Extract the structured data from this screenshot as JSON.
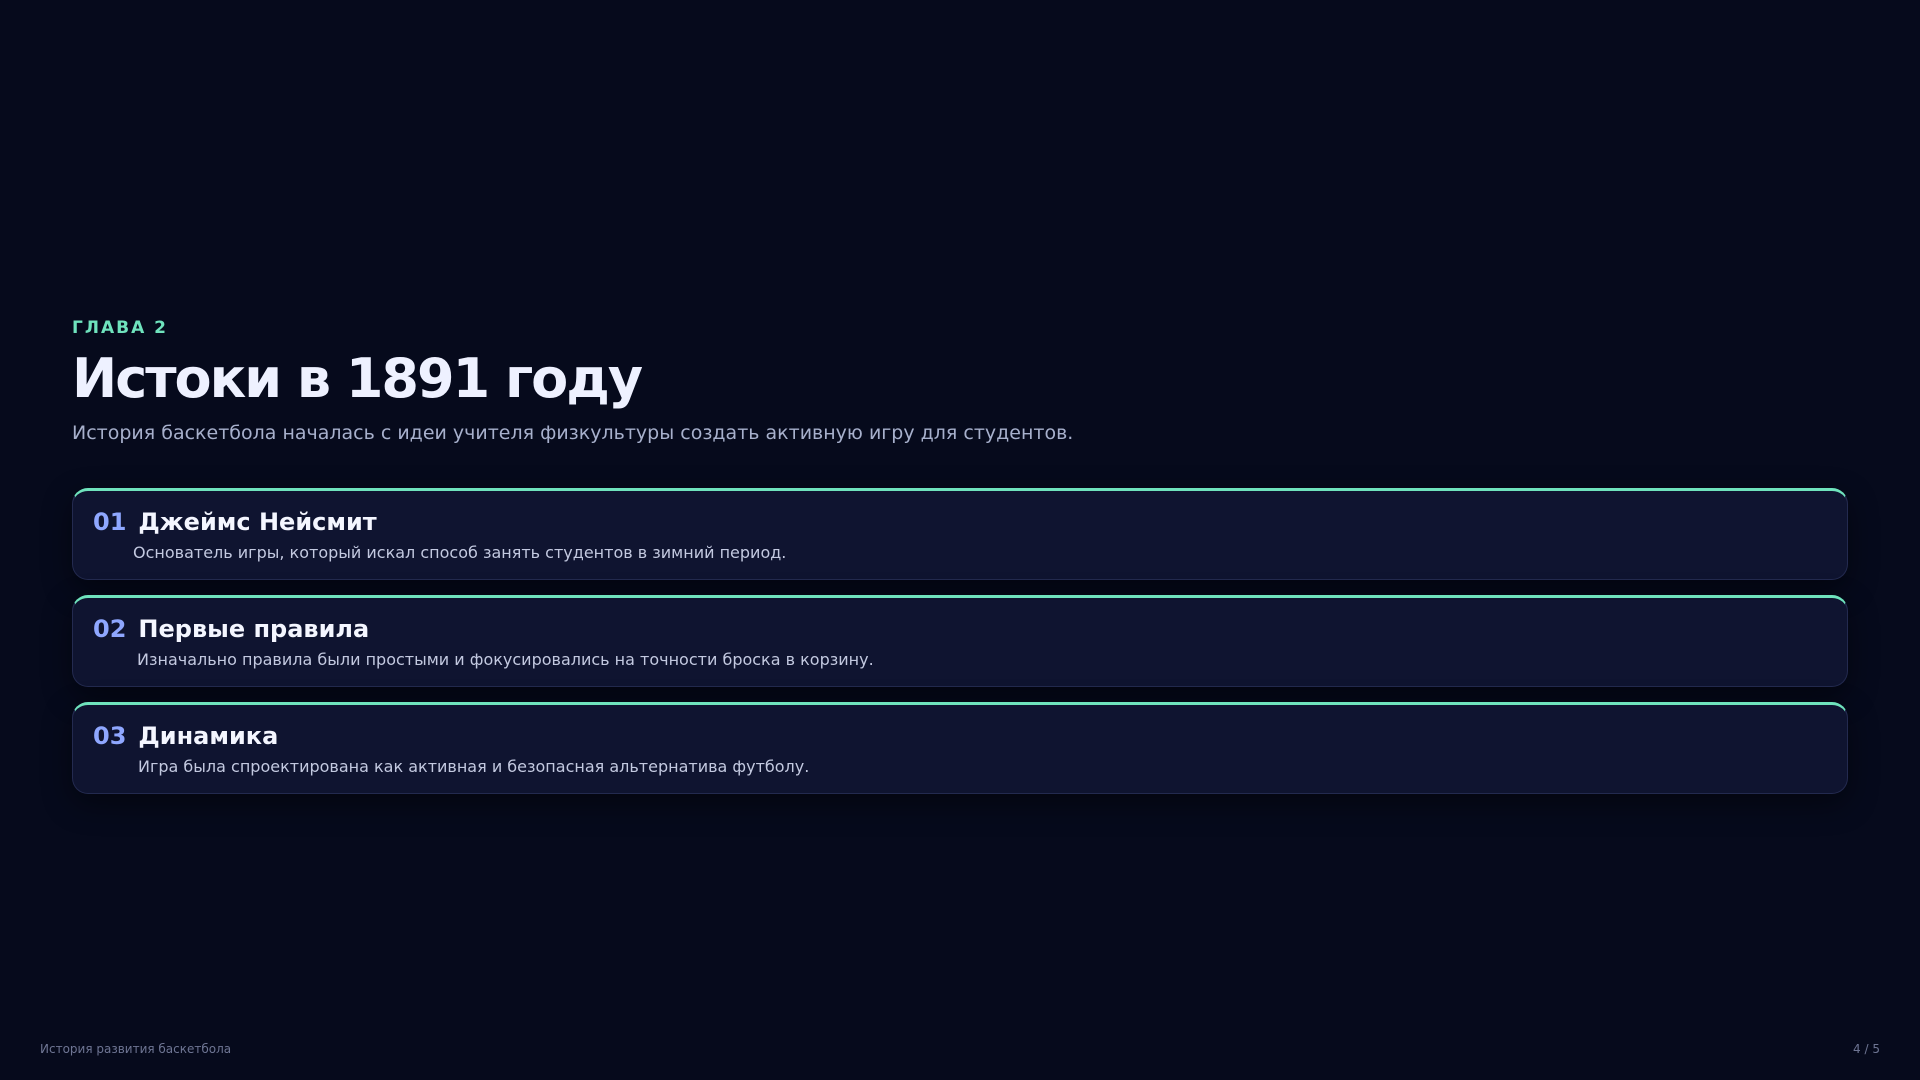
{
  "slide": {
    "kicker": "ГЛАВА 2",
    "title": "Истоки в 1891 году",
    "subtitle": "История баскетбола началась с идеи учителя физкультуры создать активную игру для студентов.",
    "cards": [
      {
        "number": "01",
        "title": "Джеймс Нейсмит",
        "description": "Основатель игры, который искал способ занять студентов в зимний период."
      },
      {
        "number": "02",
        "title": "Первые правила",
        "description": "Изначально правила были простыми и фокусировались на точности броска в корзину."
      },
      {
        "number": "03",
        "title": "Динамика",
        "description": "Игра была спроектирована как активная и безопасная альтернатива футболу."
      }
    ]
  },
  "footer": {
    "presentation_title": "История развития баскетбола",
    "page_indicator": "4 / 5"
  },
  "colors": {
    "background": "#060a1c",
    "accent": "#6fe3bd",
    "number": "#8fa7ff",
    "card_bg": "#0f1430"
  }
}
